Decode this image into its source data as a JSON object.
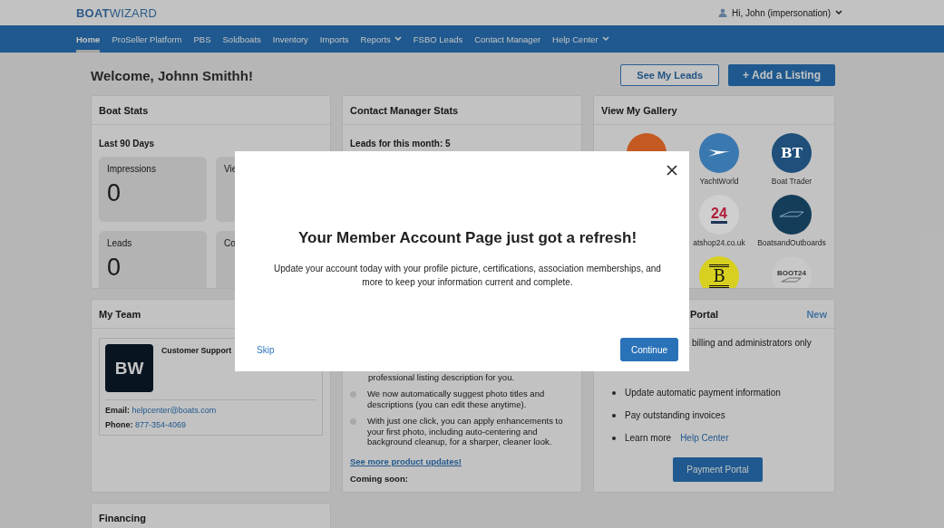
{
  "header": {
    "logo": "**BOAT**WIZARD",
    "user": "Hi, John (impersonation)"
  },
  "nav": [
    {
      "label": "Home",
      "selected": true,
      "dropdown": false
    },
    {
      "label": "ProSeller Platform",
      "selected": false,
      "dropdown": false
    },
    {
      "label": "PBS",
      "selected": false,
      "dropdown": false
    },
    {
      "label": "Soldboats",
      "selected": false,
      "dropdown": false
    },
    {
      "label": "Inventory",
      "selected": false,
      "dropdown": false
    },
    {
      "label": "Imports",
      "selected": false,
      "dropdown": false
    },
    {
      "label": "Reports",
      "selected": false,
      "dropdown": true
    },
    {
      "label": "FSBO Leads",
      "selected": false,
      "dropdown": false
    },
    {
      "label": "Contact Manager",
      "selected": false,
      "dropdown": false
    },
    {
      "label": "Help Center",
      "selected": false,
      "dropdown": true
    }
  ],
  "welcome": "Welcome, Johnn Smithh!",
  "actions": {
    "secondary": "See My Leads",
    "primary": "+ Add a Listing"
  },
  "boat_stats": {
    "title": "Boat Stats",
    "period": "Last 90 Days",
    "stats": [
      {
        "label": "Impressions",
        "value": "0"
      },
      {
        "label": "Vie"
      },
      {
        "label": "Leads",
        "value": "0"
      },
      {
        "label": "Co"
      }
    ]
  },
  "contact_stats": {
    "title": "Contact Manager Stats",
    "leads": "Leads for this month: 5"
  },
  "gallery": {
    "title": "View My Gallery",
    "rows": [
      [
        {
          "kind": "plain",
          "color": "#c45a22"
        },
        {
          "kind": "swoosh",
          "color": "#3a78b0",
          "label": "YachtWorld"
        },
        {
          "kind": "text",
          "logo_text": "BT",
          "color": "#1f4f7a",
          "label": "Boat Trader"
        }
      ],
      [
        "",
        {
          "kind": "underlined",
          "logo_text": "24",
          "color": "#cfcfcf",
          "label": "atshop24.co.uk"
        },
        {
          "kind": "boat",
          "color": "#143d5a",
          "label": "BoatsandOutboards"
        }
      ],
      [
        "",
        {
          "kind": "striped",
          "logo_text": "B",
          "color": "#d8d020"
        },
        {
          "kind": "boat-text",
          "logo_text": "BOOT24",
          "color": "#c8c8c8"
        }
      ]
    ]
  },
  "team": {
    "title": "My Team",
    "logo": "B**W**",
    "name": "Customer Support",
    "email_label": "Email:",
    "email": "helpcenter@boats.com",
    "phone_label": "Phone:",
    "phone": "877-354-4069"
  },
  "updates": {
    "continuation": "professional listing description for you.",
    "bullets": [
      "We now automatically suggest photo titles and descriptions (you can edit these anytime).",
      "With just one click, you can apply enhancements to your first photo, including auto-centering and background cleanup, for a sharper, cleaner look."
    ],
    "link": "See more product updates!",
    "coming": "Coming soon:"
  },
  "payment": {
    "title": "Portal",
    "badge": "New",
    "intro": "billing and administrators only",
    "bullets": [
      {
        "text": "Update automatic payment information"
      },
      {
        "text": "Pay outstanding invoices"
      },
      {
        "text": "Learn more",
        "link": "Help Center"
      }
    ],
    "button": "Payment Portal"
  },
  "financing": {
    "title": "Financing"
  },
  "modal": {
    "title": "Your Member Account Page just got a refresh!",
    "body": "Update your account today with your profile picture, certifications, association memberships, and more to keep your information current and complete.",
    "skip": "Skip",
    "continue": "Continue"
  }
}
